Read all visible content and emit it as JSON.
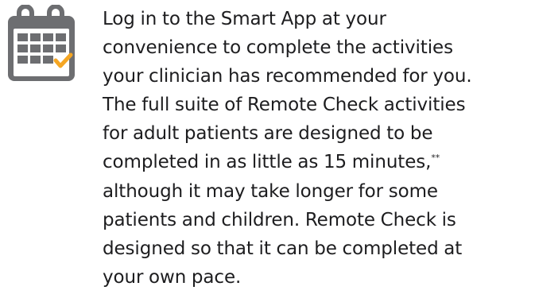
{
  "icon": {
    "name": "calendar-check-icon",
    "frame_color": "#6d6e71",
    "check_color": "#f5a623"
  },
  "content": {
    "lines": [
      "Log in to the Smart App at your",
      "convenience to complete the activities",
      "your clinician has recommended for you.",
      "The full suite of Remote Check activities",
      "for adult patients are designed to be",
      "completed in as little as 15 minutes,",
      "although it may take longer for some",
      "patients and children. Remote Check is",
      "designed so that it can be completed at",
      "your own pace."
    ],
    "footnote_mark": "**"
  }
}
